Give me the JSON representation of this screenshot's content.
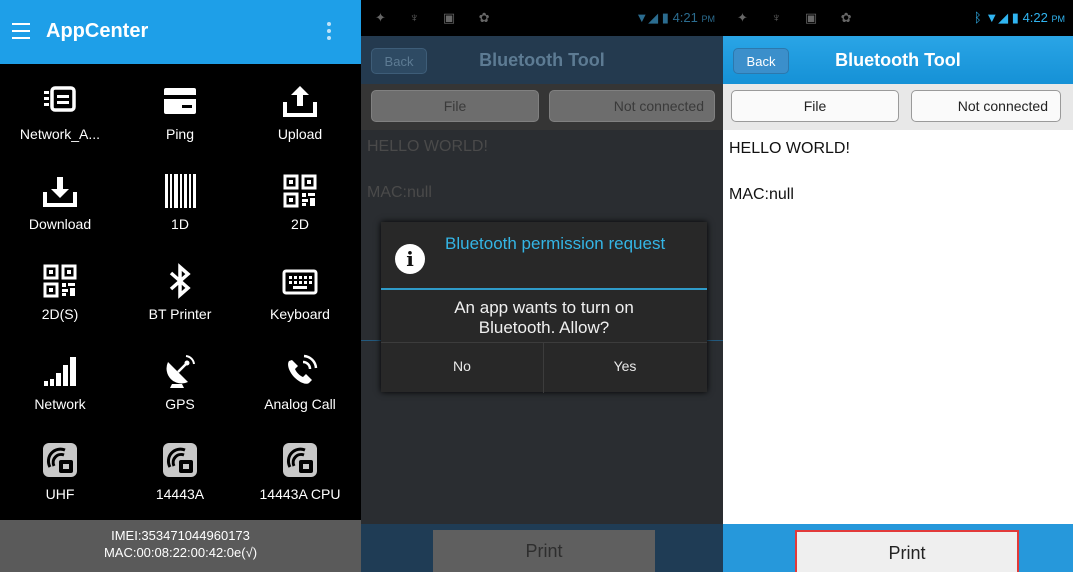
{
  "appcenter": {
    "title": "AppCenter",
    "items": [
      {
        "label": "Network_A...",
        "icon": "network-settings-icon"
      },
      {
        "label": "Ping",
        "icon": "ping-icon"
      },
      {
        "label": "Upload",
        "icon": "upload-icon"
      },
      {
        "label": "Download",
        "icon": "download-icon"
      },
      {
        "label": "1D",
        "icon": "barcode-1d-icon"
      },
      {
        "label": "2D",
        "icon": "qr-code-icon"
      },
      {
        "label": "2D(S)",
        "icon": "qr-code-icon"
      },
      {
        "label": "BT Printer",
        "icon": "bluetooth-icon"
      },
      {
        "label": "Keyboard",
        "icon": "keyboard-icon"
      },
      {
        "label": "Network",
        "icon": "signal-bars-icon"
      },
      {
        "label": "GPS",
        "icon": "satellite-dish-icon"
      },
      {
        "label": "Analog Call",
        "icon": "phone-ringing-icon"
      },
      {
        "label": "UHF",
        "icon": "rfid-icon"
      },
      {
        "label": "14443A",
        "icon": "rfid-icon"
      },
      {
        "label": "14443A CPU",
        "icon": "rfid-icon"
      }
    ],
    "footer": {
      "imei": "IMEI:353471044960173",
      "mac": "MAC:00:08:22:00:42:0e(√)"
    }
  },
  "bt_dialog_screen": {
    "time": "4:21",
    "ampm": "PM",
    "back_label": "Back",
    "title": "Bluetooth Tool",
    "file_label": "File",
    "connection_label": "Not connected",
    "content_line1": "HELLO WORLD!",
    "content_line2": "MAC:null",
    "print_label": "Print",
    "dialog": {
      "title": "Bluetooth permission request",
      "message": "An app wants to turn on Bluetooth. Allow?",
      "no_label": "No",
      "yes_label": "Yes"
    }
  },
  "bt_screen": {
    "time": "4:22",
    "ampm": "PM",
    "back_label": "Back",
    "title": "Bluetooth Tool",
    "file_label": "File",
    "connection_label": "Not connected",
    "content_line1": "HELLO WORLD!",
    "content_line2": "MAC:null",
    "print_label": "Print"
  },
  "colors": {
    "appcenter_bar": "#1e9fe8",
    "dialog_accent": "#34b5e5",
    "print_highlight": "#e23a3a"
  }
}
